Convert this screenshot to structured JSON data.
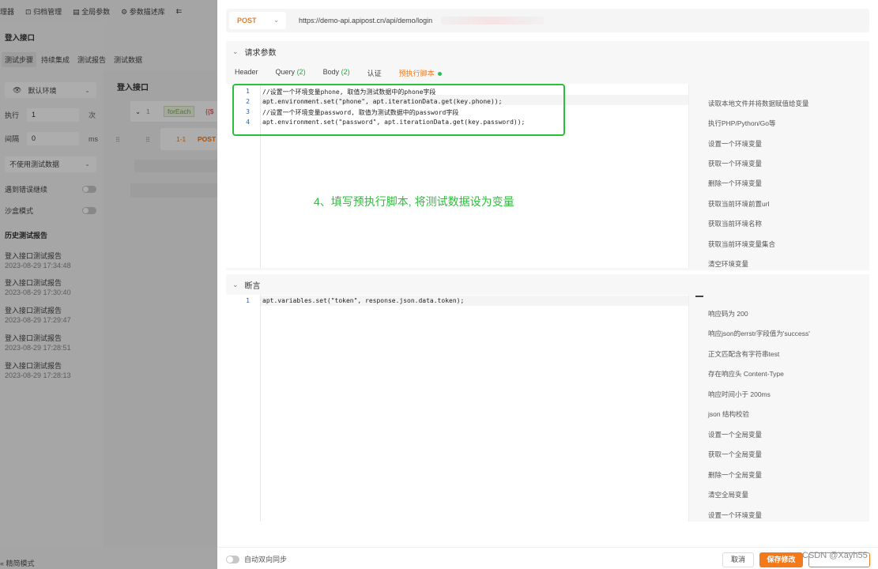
{
  "background": {
    "topbar": [
      "理器",
      "归档管理",
      "全局参数",
      "参数描述库"
    ],
    "title": "登入接口",
    "tabs": [
      "测试步骤",
      "持续集成",
      "测试报告",
      "测试数据"
    ],
    "env": "默认环境",
    "exec_label": "执行",
    "exec_value": "1",
    "exec_unit": "次",
    "interval_label": "间隔",
    "interval_value": "0",
    "interval_unit": "ms",
    "data_select": "不使用测试数据",
    "toggle1": "遇到错误继续",
    "toggle2": "沙盒模式",
    "history_title": "历史测试报告",
    "reports": [
      {
        "name": "登入接口测试报告",
        "time": "2023-08-29 17:34:48"
      },
      {
        "name": "登入接口测试报告",
        "time": "2023-08-29 17:30:40"
      },
      {
        "name": "登入接口测试报告",
        "time": "2023-08-29 17:29:47"
      },
      {
        "name": "登入接口测试报告",
        "time": "2023-08-29 17:28:51"
      },
      {
        "name": "登入接口测试报告",
        "time": "2023-08-29 17:28:13"
      }
    ],
    "mid_title": "登入接口",
    "mid_num": "1",
    "mid_foreach": "forEach",
    "mid_var": "{{$",
    "mid_step": "1-1",
    "mid_method": "POST",
    "bottom": "精简模式"
  },
  "request": {
    "method": "POST",
    "url": "https://demo-api.apipost.cn/api/demo/login"
  },
  "params_section": {
    "title": "请求参数",
    "tabs": {
      "header": "Header",
      "query": "Query",
      "query_count": "(2)",
      "body": "Body",
      "body_count": "(2)",
      "auth": "认证",
      "pre_script": "预执行脚本"
    }
  },
  "pre_script": {
    "line_numbers": [
      "1",
      "2",
      "3",
      "4"
    ],
    "lines": [
      "//设置一个环境变量phone, 取值为测试数据中的phone字段",
      "apt.environment.set(\"phone\", apt.iterationData.get(key.phone));",
      "//设置一个环境变量password, 取值为测试数据中的password字段",
      "apt.environment.set(\"password\", apt.iterationData.get(key.password));"
    ],
    "snippets": [
      "读取本地文件并将数据赋值给变量",
      "执行PHP/Python/Go等",
      "设置一个环境变量",
      "获取一个环境变量",
      "删除一个环境变量",
      "获取当前环境前置url",
      "获取当前环境名称",
      "获取当前环境变量集合",
      "清空环境变量"
    ]
  },
  "annotation": "4、填写预执行脚本, 将测试数据设为变量",
  "assert_section": {
    "title": "断言",
    "line_numbers": [
      "1"
    ],
    "lines": [
      "apt.variables.set(\"token\", response.json.data.token);"
    ],
    "snippets": [
      "响应码为 200",
      "响应json的errstr字段值为'success'",
      "正文匹配含有字符串test",
      "存在响应头 Content-Type",
      "响应时间小于 200ms",
      "json 结构校验",
      "设置一个全局变量",
      "获取一个全局变量",
      "删除一个全局变量",
      "清空全局变量",
      "设置一个环境变量"
    ]
  },
  "footer": {
    "sync_label": "自动双向同步",
    "cancel": "取消",
    "save": "保存修改",
    "watermark": "CSDN @Xayh55"
  },
  "colors": {
    "accent": "#f27a1a",
    "annotation_green": "#2bbf3a",
    "count_green": "#27a844"
  }
}
